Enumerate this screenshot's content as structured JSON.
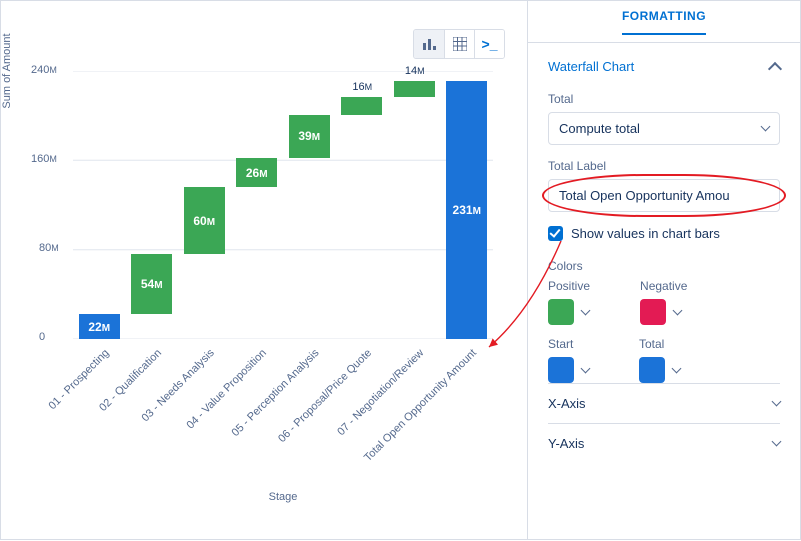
{
  "panel": {
    "tab_label": "FORMATTING",
    "section_title": "Waterfall Chart",
    "total_label": "Total",
    "total_select_value": "Compute total",
    "total_label_label": "Total Label",
    "total_label_value": "Total Open Opportunity Amou",
    "show_values_label": "Show values in chart bars",
    "colors_label": "Colors",
    "positive_label": "Positive",
    "negative_label": "Negative",
    "start_label": "Start",
    "total_color_label": "Total",
    "xaxis_label": "X-Axis",
    "yaxis_label": "Y-Axis",
    "colors": {
      "positive": "#3ba755",
      "negative": "#e31b54",
      "start": "#1b73d8",
      "total": "#1b73d8"
    }
  },
  "yaxis_title": "Sum of Amount",
  "xaxis_title": "Stage",
  "chart_data": {
    "type": "waterfall",
    "ylabel": "Sum of Amount",
    "xlabel": "Stage",
    "ylim": [
      0,
      240
    ],
    "yunit": "M",
    "yticks": [
      0,
      80,
      160,
      240
    ],
    "categories": [
      "01 - Prospecting",
      "02 - Qualification",
      "03 - Needs Analysis",
      "04 - Value Proposition",
      "05 - Perception Analysis",
      "06 - Proposal/Price Quote",
      "07 - Negotiation/Review",
      "Total Open Opportunity Amount"
    ],
    "values": [
      22,
      54,
      60,
      26,
      39,
      16,
      14,
      231
    ],
    "roles": [
      "start",
      "positive",
      "positive",
      "positive",
      "positive",
      "positive",
      "positive",
      "total"
    ],
    "label_position": [
      "inside",
      "inside",
      "inside",
      "inside",
      "inside",
      "above",
      "above",
      "inside"
    ]
  }
}
